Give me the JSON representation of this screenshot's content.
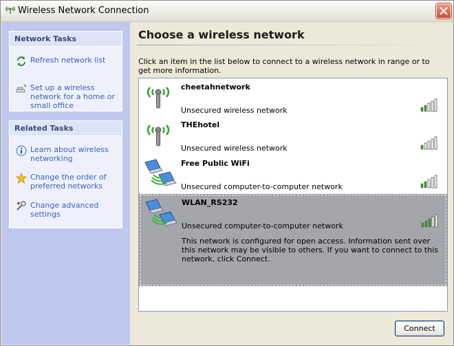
{
  "window": {
    "title": "Wireless Network Connection"
  },
  "sidebar": {
    "network_tasks": {
      "heading": "Network Tasks",
      "items": [
        {
          "label": "Refresh network list",
          "icon": "refresh-icon"
        },
        {
          "label": "Set up a wireless network for a home or small office",
          "icon": "setup-wizard-icon"
        }
      ]
    },
    "related_tasks": {
      "heading": "Related Tasks",
      "items": [
        {
          "label": "Learn about wireless networking",
          "icon": "info-icon"
        },
        {
          "label": "Change the order of preferred networks",
          "icon": "star-icon"
        },
        {
          "label": "Change advanced settings",
          "icon": "tools-icon"
        }
      ]
    }
  },
  "main": {
    "title": "Choose a wireless network",
    "intro": "Click an item in the list below to connect to a wireless network in range or to get more information.",
    "networks": [
      {
        "name": "cheetahnetwork",
        "status": "Unsecured wireless network",
        "icon": "access-point-icon",
        "signal_bars": 5,
        "selected": false
      },
      {
        "name": "THEhotel",
        "status": "Unsecured wireless network",
        "icon": "access-point-icon",
        "signal_bars": 5,
        "selected": false
      },
      {
        "name": "Free Public WiFi",
        "status": "Unsecured computer-to-computer network",
        "icon": "computer-to-computer-icon",
        "signal_bars": 5,
        "selected": false
      },
      {
        "name": "WLAN_RS232",
        "status": "Unsecured computer-to-computer network",
        "icon": "computer-to-computer-icon",
        "signal_bars": 5,
        "selected": true,
        "info": "This network is configured for open access. Information sent over this network may be visible to others. If you want to connect to this network, click Connect."
      }
    ],
    "connect_label": "Connect"
  },
  "colors": {
    "task_link": "#3a5ec6",
    "selected_row": "#a4a6ab",
    "signal_green": "#3c9b22"
  }
}
